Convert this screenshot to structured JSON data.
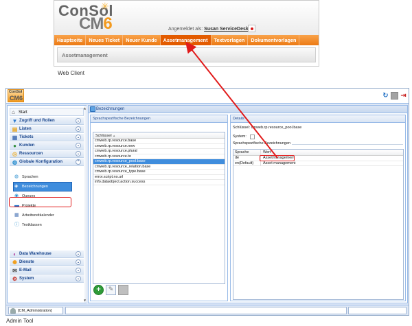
{
  "web_client": {
    "logo_consol": "ConSol",
    "logo_cm": "CM",
    "logo_six": "6",
    "logged_in_label": "Angemeldet als:",
    "logged_in_user": "Susan ServiceDesk",
    "nav": [
      "Hauptseite",
      "Neues Ticket",
      "Neuer Kunde",
      "Assetmanagement",
      "Textvorlagen",
      "Dokumentvorlagen"
    ],
    "active_nav": "Assetmanagement",
    "subtitle": "Assetmanagement",
    "caption": "Web Client"
  },
  "admin_tool": {
    "logo_top": "ConSol",
    "logo_bottom": "CM6",
    "nav": {
      "start": "Start",
      "groups_top": [
        "Zugriff und Rollen",
        "Listen",
        "Tickets",
        "Kunden",
        "Ressourcen",
        "Globale Konfiguration"
      ],
      "sub_items": [
        "Sprachen",
        "Bezeichnungen",
        "Queues",
        "Projekte",
        "Arbeitszeitkalender",
        "Textklassen"
      ],
      "selected_sub": "Bezeichnungen",
      "groups_bottom": [
        "Data Warehouse",
        "Dienste",
        "E-Mail",
        "System"
      ]
    },
    "main_title": "Bezeichnungen",
    "lang_panel": {
      "title": "Sprachspezifische Bezeichnungen",
      "column": "Schlüssel",
      "sort_arrow": "▲",
      "keys": [
        "cmweb.rp.resource.base",
        "cmweb.rp.resource.new",
        "cmweb.rp.resource.plural",
        "cmweb.rp.resource.to",
        "cmweb.rp.resource_pool.base",
        "cmweb.rp.resource_relation.base",
        "cmweb.rp.resource_type.base",
        "error.script.no.url",
        "info.dataobject.action.success"
      ],
      "selected_key": "cmweb.rp.resource_pool.base"
    },
    "details": {
      "title": "Details",
      "key_label": "Schlüssel:",
      "key_value": "cmweb.rp.resource_pool.base",
      "system_label": "System:",
      "section": "Sprachspezifische Bezeichnungen",
      "columns": [
        "Sprache",
        "Wert"
      ],
      "rows": [
        {
          "lang": "de",
          "value": "Assetmanagement"
        },
        {
          "lang": "en(Default)",
          "value": "Asset management"
        }
      ]
    },
    "status_user": "[CM_Administration]",
    "caption": "Admin Tool"
  },
  "colors": {
    "annotation_red": "#e11b1b",
    "web_nav_orange": "#ec7a14",
    "selection_blue": "#3f8ddd"
  }
}
